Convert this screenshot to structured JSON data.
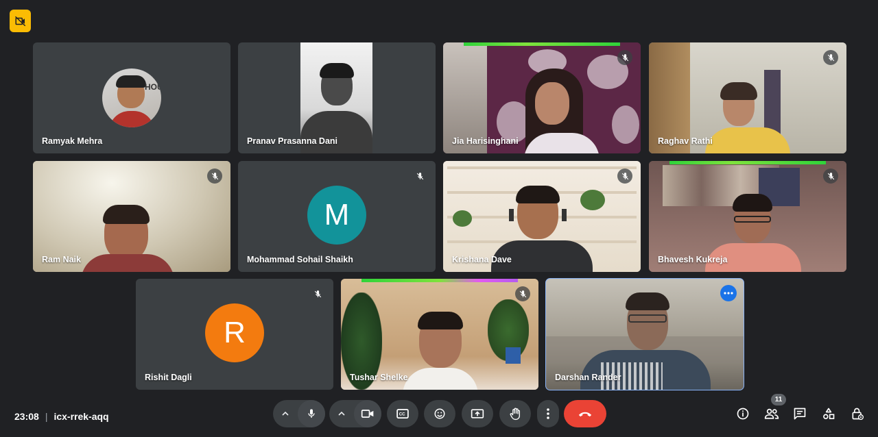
{
  "meeting": {
    "time": "23:08",
    "code": "icx-rrek-aqq"
  },
  "participants_count": "11",
  "tiles": {
    "ramyak": {
      "name": "Ramyak Mehra"
    },
    "pranav": {
      "name": "Pranav Prasanna Dani"
    },
    "jia": {
      "name": "Jia Harisinghani"
    },
    "raghav": {
      "name": "Raghav Rathi"
    },
    "ram": {
      "name": "Ram Naik"
    },
    "mohammad": {
      "name": "Mohammad Sohail Shaikh",
      "avatar_letter": "M"
    },
    "krishana": {
      "name": "Krishana Dave"
    },
    "bhavesh": {
      "name": "Bhavesh Kukreja"
    },
    "rishit": {
      "name": "Rishit Dagli",
      "avatar_letter": "R"
    },
    "tushar": {
      "name": "Tushar Shelke"
    },
    "darshan": {
      "name": "Darshan Rander"
    }
  },
  "colors": {
    "avatar_m": "#12939a",
    "avatar_r": "#f37b0f",
    "end_call": "#ea4335",
    "accent": "#1a73e8",
    "recording": "#fbbc04"
  },
  "icons": [
    "recording-off-icon",
    "mic-icon",
    "camera-icon",
    "captions-icon",
    "emoji-icon",
    "present-icon",
    "raise-hand-icon",
    "more-options-icon",
    "end-call-icon",
    "info-icon",
    "people-icon",
    "chat-icon",
    "activities-icon",
    "host-controls-icon",
    "mic-off-icon"
  ]
}
